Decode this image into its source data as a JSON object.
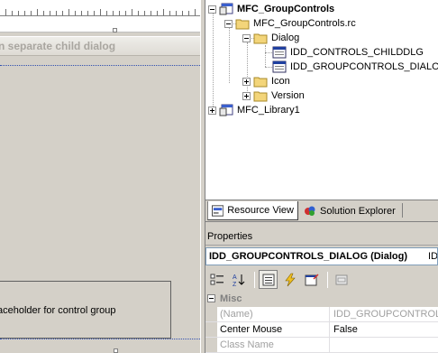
{
  "editor": {
    "caption_text": "n separate child dialog",
    "placeholder_text": "aceholder for control group"
  },
  "tree": {
    "items": [
      {
        "label": "MFC_GroupControls",
        "icon": "project-icon",
        "expander": "minus",
        "bold": true
      },
      {
        "label": "MFC_GroupControls.rc",
        "icon": "folder-icon",
        "expander": "minus",
        "bold": false
      },
      {
        "label": "Dialog",
        "icon": "folder-icon",
        "expander": "minus",
        "bold": false
      },
      {
        "label": "IDD_CONTROLS_CHILDDLG",
        "icon": "dialog-resource-icon",
        "expander": "none",
        "bold": false
      },
      {
        "label": "IDD_GROUPCONTROLS_DIALOG",
        "icon": "dialog-resource-icon",
        "expander": "none",
        "bold": false
      },
      {
        "label": "Icon",
        "icon": "folder-icon",
        "expander": "plus",
        "bold": false
      },
      {
        "label": "Version",
        "icon": "folder-icon",
        "expander": "plus",
        "bold": false
      },
      {
        "label": "MFC_Library1",
        "icon": "project-icon",
        "expander": "plus",
        "bold": false
      }
    ]
  },
  "tabs": [
    {
      "label": "Resource View",
      "icon": "resource-view-icon",
      "active": true
    },
    {
      "label": "Solution Explorer",
      "icon": "solution-explorer-icon",
      "active": false
    }
  ],
  "properties": {
    "title": "Properties",
    "object_name": "IDD_GROUPCONTROLS_DIALOG (Dialog)",
    "object_type_fragment": "ID",
    "category": "Misc",
    "rows": [
      {
        "name": "(Name)",
        "value": "IDD_GROUPCONTROLS_",
        "muted": true
      },
      {
        "name": "Center Mouse",
        "value": "False",
        "muted": false
      },
      {
        "name": "Class Name",
        "value": "",
        "muted": true
      }
    ]
  },
  "colors": {
    "chrome": "#d4d0c8",
    "folder": "#f3d57a",
    "selection_dotted": "#3050b0"
  }
}
